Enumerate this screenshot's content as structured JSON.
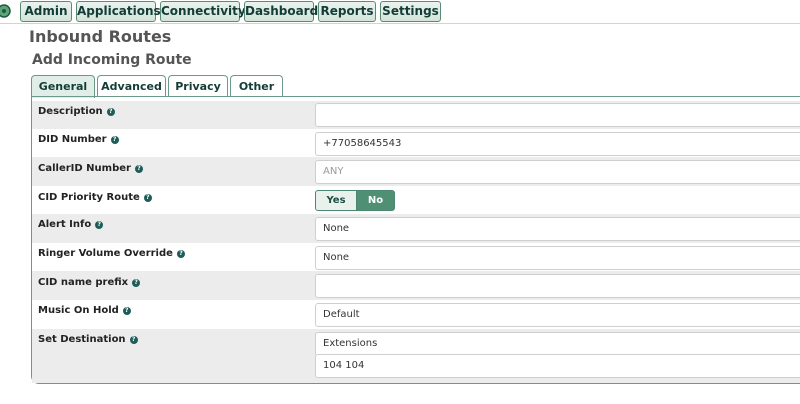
{
  "nav": {
    "items": [
      {
        "label": "Admin"
      },
      {
        "label": "Applications"
      },
      {
        "label": "Connectivity"
      },
      {
        "label": "Dashboard"
      },
      {
        "label": "Reports"
      },
      {
        "label": "Settings"
      }
    ]
  },
  "page": {
    "title": "Inbound Routes",
    "subtitle": "Add Incoming Route"
  },
  "tabs": [
    {
      "label": "General"
    },
    {
      "label": "Advanced"
    },
    {
      "label": "Privacy"
    },
    {
      "label": "Other"
    }
  ],
  "form": {
    "description": {
      "label": "Description",
      "value": ""
    },
    "did_number": {
      "label": "DID Number",
      "value": "+77058645543"
    },
    "callerid_number": {
      "label": "CallerID Number",
      "placeholder": "ANY"
    },
    "cid_priority_route": {
      "label": "CID Priority Route",
      "yes": "Yes",
      "no": "No",
      "selected": "No"
    },
    "alert_info": {
      "label": "Alert Info",
      "value": "None"
    },
    "ringer_volume_override": {
      "label": "Ringer Volume Override",
      "value": "None"
    },
    "cid_name_prefix": {
      "label": "CID name prefix",
      "value": ""
    },
    "music_on_hold": {
      "label": "Music On Hold",
      "value": "Default"
    },
    "set_destination": {
      "label": "Set Destination",
      "type": "Extensions",
      "target": "104 104"
    }
  },
  "help_glyph": "?",
  "colors": {
    "accent": "#4f8f74",
    "nav_text": "#123c35",
    "row_shade": "#ececec"
  }
}
